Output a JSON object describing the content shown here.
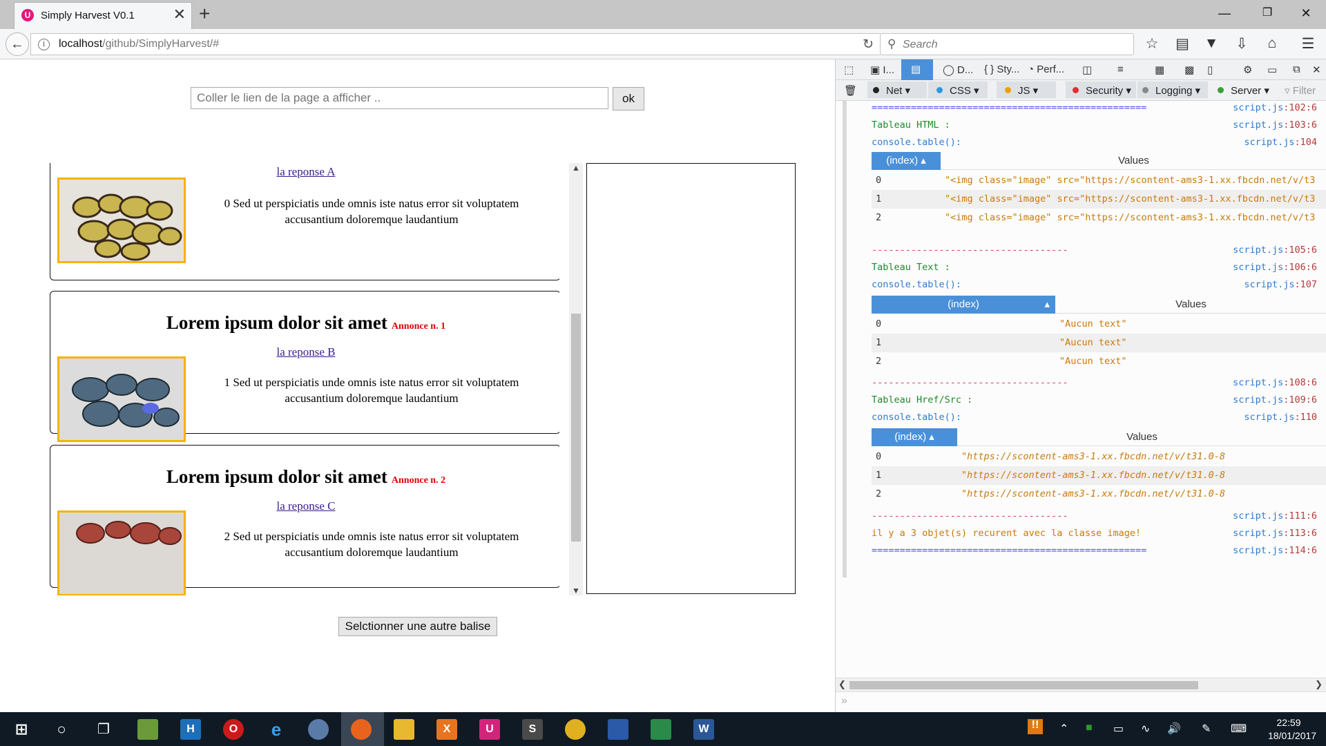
{
  "browser": {
    "tab_title": "Simply Harvest V0.1",
    "tab_close": "✕",
    "new_tab": "+",
    "tab_icon_letter": "U",
    "url_host": "localhost",
    "url_path": "/github/SimplyHarvest/#",
    "search_placeholder": "Search",
    "window_controls": {
      "minimize": "—",
      "maximize": "❐",
      "close": "✕"
    },
    "nav_icons": [
      "star-icon",
      "reading-list-icon",
      "pocket-icon",
      "download-icon",
      "home-icon",
      "menu-icon"
    ]
  },
  "page": {
    "link_input_placeholder": "Coller le lien de la page a afficher ..",
    "ok_label": "ok",
    "select_button_label": "Selctionner une autre balise",
    "cards": [
      {
        "title": "",
        "annonce": "",
        "response": "la reponse A",
        "desc": "0 Sed ut perspiciatis unde omnis iste natus error sit voluptatem accusantium doloremque laudantium",
        "stone_color": "#c9b650"
      },
      {
        "title": "Lorem ipsum dolor sit amet",
        "annonce": "Annonce n. 1",
        "response": "la reponse B",
        "desc": "1 Sed ut perspiciatis unde omnis iste natus error sit voluptatem accusantium doloremque laudantium",
        "stone_color": "#4f6a80"
      },
      {
        "title": "Lorem ipsum dolor sit amet",
        "annonce": "Annonce n. 2",
        "response": "la reponse C",
        "desc": "2 Sed ut perspiciatis unde omnis iste natus error sit voluptatem accusantium doloremque laudantium",
        "stone_color": "#a8463c"
      }
    ]
  },
  "devtools": {
    "tabs": [
      "I...",
      "D...",
      "Sty...",
      "Perf..."
    ],
    "filters": [
      {
        "label": "Net",
        "color": "#222222"
      },
      {
        "label": "CSS",
        "color": "#2d9ad8"
      },
      {
        "label": "JS",
        "color": "#f0a000"
      },
      {
        "label": "Security",
        "color": "#e03030"
      },
      {
        "label": "Logging",
        "color": "#888888"
      },
      {
        "label": "Server",
        "color": "#3aa03a"
      }
    ],
    "filter_placeholder": "Filter",
    "console": {
      "sep_long": "=================================================",
      "sep_short": "-----------------------------------",
      "lines": {
        "l1_src": "script.js",
        "l1_ln": ":102:6",
        "html_label": "Tableau HTML :",
        "l2_ln": ":103:6",
        "console_table": "console.table():",
        "l3_ln": ":104",
        "l4_ln": ":105:6",
        "text_label": "Tableau Text :",
        "l5_ln": ":106:6",
        "l6_ln": ":107",
        "l7_ln": ":108:6",
        "href_label": "Tableau Href/Src :",
        "l8_ln": ":109:6",
        "l9_ln": ":110",
        "l10_ln": ":111:6",
        "summary": "il y a 3 objet(s) recurent avec la classe image!",
        "l11_ln": ":113:6",
        "l12_ln": ":114:6"
      },
      "table_header_index": "(index)",
      "table_header_values": "Values",
      "html_rows": [
        {
          "i": "0",
          "v": "\"<img class=\"image\" src=\"https://scontent-ams3-1.xx.fbcdn.net/v/t3"
        },
        {
          "i": "1",
          "v": "\"<img class=\"image\" src=\"https://scontent-ams3-1.xx.fbcdn.net/v/t3"
        },
        {
          "i": "2",
          "v": "\"<img class=\"image\" src=\"https://scontent-ams3-1.xx.fbcdn.net/v/t3"
        }
      ],
      "text_rows": [
        {
          "i": "0",
          "v": "\"Aucun text\""
        },
        {
          "i": "1",
          "v": "\"Aucun text\""
        },
        {
          "i": "2",
          "v": "\"Aucun text\""
        }
      ],
      "href_rows": [
        {
          "i": "0",
          "v": "\"https://scontent-ams3-1.xx.fbcdn.net/v/t31.0-8"
        },
        {
          "i": "1",
          "v": "\"https://scontent-ams3-1.xx.fbcdn.net/v/t31.0-8"
        },
        {
          "i": "2",
          "v": "\"https://scontent-ams3-1.xx.fbcdn.net/v/t31.0-8"
        }
      ]
    }
  },
  "taskbar": {
    "time": "22:59",
    "date": "18/01/2017"
  }
}
